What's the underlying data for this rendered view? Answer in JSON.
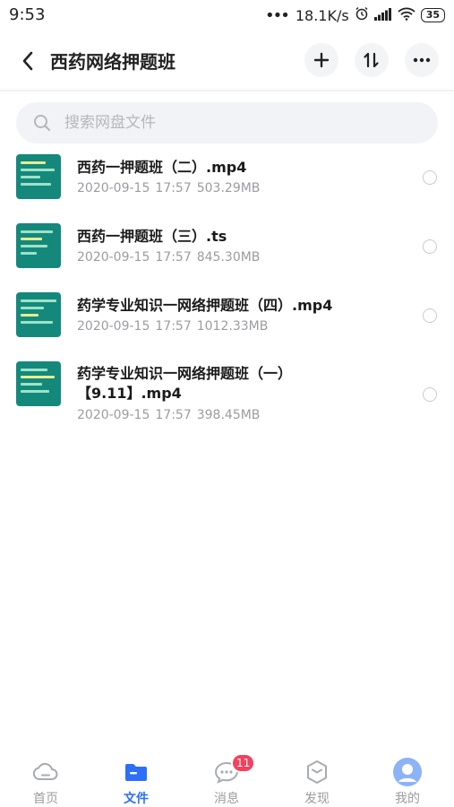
{
  "status_bar": {
    "time": "9:53",
    "network_speed": "18.1K/s",
    "battery": "35"
  },
  "header": {
    "title": "西药网络押题班",
    "icons": {
      "back": "chevron-left",
      "add": "plus",
      "sort": "sort-arrows",
      "more": "ellipsis"
    }
  },
  "search": {
    "placeholder": "搜索网盘文件"
  },
  "files": [
    {
      "name": "西药一押题班（二）.mp4",
      "date": "2020-09-15",
      "time": "17:57",
      "size": "503.29MB"
    },
    {
      "name": "西药一押题班（三）.ts",
      "date": "2020-09-15",
      "time": "17:57",
      "size": "845.30MB"
    },
    {
      "name": "药学专业知识一网络押题班（四）.mp4",
      "date": "2020-09-15",
      "time": "17:57",
      "size": "1012.33MB"
    },
    {
      "name_line1": "药学专业知识一网络押题班（一）",
      "name_line2": "【9.11】.mp4",
      "date": "2020-09-15",
      "time": "17:57",
      "size": "398.45MB"
    }
  ],
  "bottom_nav": [
    {
      "label": "首页",
      "icon": "cloud"
    },
    {
      "label": "文件",
      "icon": "folder",
      "active": true
    },
    {
      "label": "消息",
      "icon": "chat-bubble",
      "badge": "11"
    },
    {
      "label": "发现",
      "icon": "cube"
    },
    {
      "label": "我的",
      "icon": "avatar"
    }
  ],
  "colors": {
    "accent": "#2d6ff7",
    "badge": "#f5405f",
    "thumbnail": "#15887c",
    "muted_text": "#9a9ca1"
  }
}
